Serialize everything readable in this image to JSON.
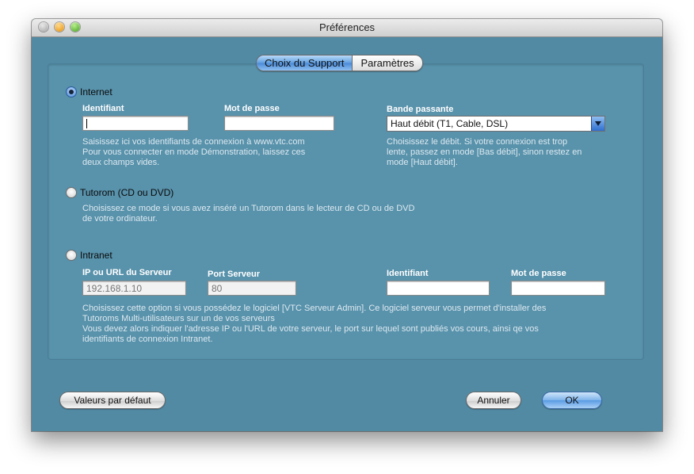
{
  "window": {
    "title": "Préférences"
  },
  "tabs": [
    {
      "label": "Choix du Support",
      "active": true
    },
    {
      "label": "Paramètres",
      "active": false
    }
  ],
  "internet": {
    "label": "Internet",
    "selected": true,
    "identifiant_label": "Identifiant",
    "identifiant_value": "",
    "password_label": "Mot de passe",
    "password_value": "",
    "help_1": "Saisissez ici vos identifiants de connexion à www.vtc.com",
    "help_2": "Pour vous connecter en mode Démonstration, laissez ces",
    "help_3": "deux champs vides.",
    "bandwidth_label": "Bande passante",
    "bandwidth_value": "Haut débit (T1, Cable, DSL)",
    "bandwidth_help_1": "Choisissez le débit. Si votre connexion est trop",
    "bandwidth_help_2": "lente, passez en mode [Bas débit], sinon restez en",
    "bandwidth_help_3": "mode [Haut débit]."
  },
  "tutorom": {
    "label": "Tutorom (CD ou DVD)",
    "selected": false,
    "help_1": "Choisissez ce mode si vous avez inséré un Tutorom dans le lecteur de CD ou de DVD",
    "help_2": "de votre ordinateur."
  },
  "intranet": {
    "label": "Intranet",
    "selected": false,
    "ip_label": "IP ou URL du Serveur",
    "ip_placeholder": "192.168.1.10",
    "port_label": "Port Serveur",
    "port_placeholder": "80",
    "identifiant_label": "Identifiant",
    "password_label": "Mot de passe",
    "help_1": "Choisissez cette option si vous possédez le logiciel [VTC Serveur Admin]. Ce logiciel serveur vous permet d'installer des",
    "help_2": "Tutoroms Multi-utilisateurs sur un de vos serveurs",
    "help_3": "Vous devez alors indiquer l'adresse IP ou l'URL de votre serveur, le port sur lequel sont publiés vos cours, ainsi qe vos",
    "help_4": "identifiants de connexion Intranet."
  },
  "buttons": {
    "defaults_label": "Valeurs par défaut",
    "cancel_label": "Annuler",
    "ok_label": "OK"
  },
  "colors": {
    "window_bg": "#528aa4",
    "accent_blue": "#5a9be3"
  }
}
